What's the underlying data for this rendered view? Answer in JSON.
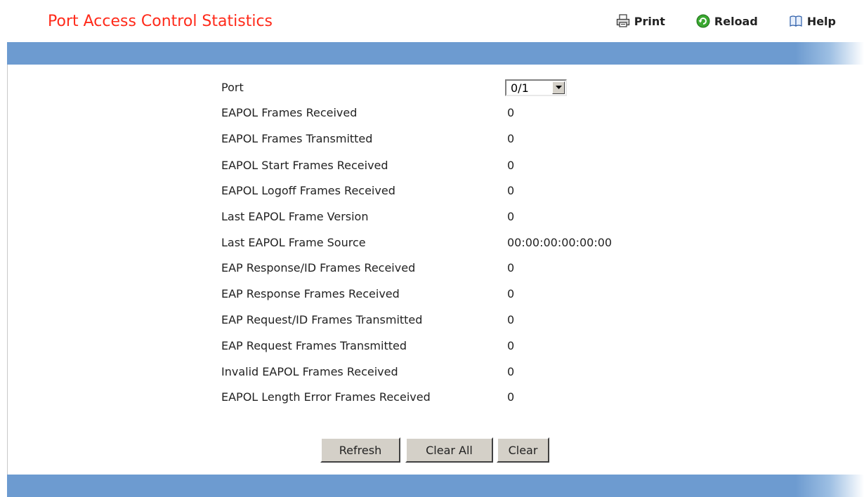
{
  "header": {
    "title": "Port Access Control Statistics",
    "actions": [
      {
        "label": "Print",
        "icon": "printer-icon"
      },
      {
        "label": "Reload",
        "icon": "reload-icon"
      },
      {
        "label": "Help",
        "icon": "book-icon"
      }
    ]
  },
  "form": {
    "port": {
      "label": "Port",
      "selected": "0/1"
    },
    "stats": [
      {
        "label": "EAPOL Frames Received",
        "value": "0"
      },
      {
        "label": "EAPOL Frames Transmitted",
        "value": "0"
      },
      {
        "label": "EAPOL Start Frames Received",
        "value": "0"
      },
      {
        "label": "EAPOL Logoff Frames Received",
        "value": "0"
      },
      {
        "label": "Last EAPOL Frame Version",
        "value": "0"
      },
      {
        "label": "Last EAPOL Frame Source",
        "value": "00:00:00:00:00:00"
      },
      {
        "label": "EAP Response/ID Frames Received",
        "value": "0"
      },
      {
        "label": "EAP Response Frames Received",
        "value": "0"
      },
      {
        "label": "EAP Request/ID Frames Transmitted",
        "value": "0"
      },
      {
        "label": "EAP Request Frames Transmitted",
        "value": "0"
      },
      {
        "label": "Invalid EAPOL Frames Received",
        "value": "0"
      },
      {
        "label": "EAPOL Length Error Frames Received",
        "value": "0"
      }
    ]
  },
  "buttons": {
    "refresh": "Refresh",
    "clear_all": "Clear All",
    "clear": "Clear"
  },
  "colors": {
    "title": "#ff2a1a",
    "bar": "#6d9bd0",
    "button_face": "#d4d0c8"
  }
}
